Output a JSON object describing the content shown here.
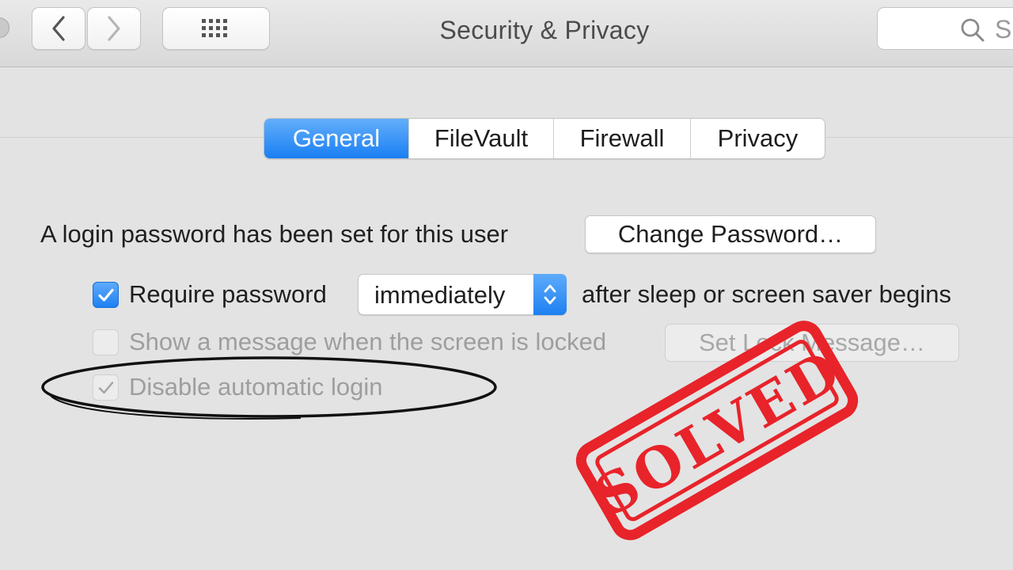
{
  "window": {
    "title": "Security & Privacy"
  },
  "toolbar": {
    "search_text": "S"
  },
  "tabs": [
    {
      "label": "General",
      "active": true
    },
    {
      "label": "FileVault",
      "active": false
    },
    {
      "label": "Firewall",
      "active": false
    },
    {
      "label": "Privacy",
      "active": false
    }
  ],
  "general": {
    "login_password_text": "A login password has been set for this user",
    "change_password_label": "Change Password…",
    "require_password": {
      "checked": true,
      "label": "Require password"
    },
    "require_delay": {
      "value": "immediately"
    },
    "after_sleep_text": "after sleep or screen saver begins",
    "show_message": {
      "checked": false,
      "enabled": false,
      "label": "Show a message when the screen is locked"
    },
    "set_lock_message_label": "Set Lock Message…",
    "disable_auto_login": {
      "checked": true,
      "enabled": false,
      "label": "Disable automatic login"
    }
  },
  "overlay": {
    "stamp_text": "SOLVED",
    "stamp_color": "#e8232a"
  },
  "colors": {
    "accent": "#1a7ff3",
    "background": "#e3e3e3"
  }
}
